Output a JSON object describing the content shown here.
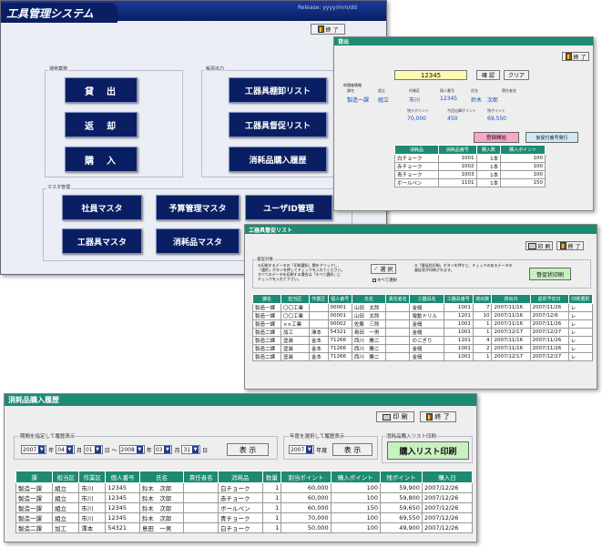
{
  "main": {
    "title": "工具管理システム",
    "release": "Release: yyyy/mm/dd",
    "exit": "終 了",
    "group_daily": "通常業務",
    "group_output": "帳票出力",
    "group_master": "マスタ管理",
    "btn_lend": "貸　出",
    "btn_return": "返　却",
    "btn_purchase": "購　入",
    "btn_inventory": "工器具棚卸リスト",
    "btn_reminder": "工器具督促リスト",
    "btn_history": "消耗品購入履歴",
    "btn_employee": "社員マスタ",
    "btn_budget": "予算管理マスタ",
    "btn_userid": "ユーザID管理",
    "btn_toolmaster": "工器具マスタ",
    "btn_consumable": "消耗品マスタ"
  },
  "lend": {
    "title": "貸出",
    "exit": "終 了",
    "id_value": "12345",
    "clear": "クリア",
    "confirm": "確 認",
    "employee_label": "申請者情報",
    "labels": [
      "課名",
      "組立",
      "作業区",
      "個人番号",
      "氏名",
      "責任者名"
    ],
    "values": [
      "製造一課",
      "組立",
      "市川",
      "12345",
      "鈴木　次郎"
    ],
    "label_row2": [
      "残りポイント",
      "今回出庫ポイント",
      "残ポイント"
    ],
    "values_row2": [
      "70,000",
      "450",
      "69,550"
    ],
    "btn_register": "登録開始",
    "btn_reissue": "仮受付番号発行",
    "headers": [
      "消耗品",
      "消耗品番号",
      "購入数",
      "購入ポイント"
    ],
    "rows": [
      [
        "白チョーク",
        "1001",
        "1本",
        "100"
      ],
      [
        "赤チョーク",
        "1002",
        "1本",
        "100"
      ],
      [
        "青チョーク",
        "1003",
        "1本",
        "100"
      ],
      [
        "ボールペン",
        "1101",
        "1本",
        "150"
      ]
    ]
  },
  "reminder": {
    "title": "工器具督促リスト",
    "print": "印 刷",
    "exit": "終 了",
    "group": "督促対象",
    "note1": "①印刷するデータの「印刷選択」欄をクリックし、",
    "note2": "「選択」ボタンを押してチェックを入れてください。",
    "note3": "すべてのデータを印刷する場合は「すべて選択」に",
    "note4": "チェックを入れて下さい。",
    "select": "選 択",
    "select_all": "すべて選択",
    "note5": "②「督促状印刷」ボタンを押すと、チェックのあるデータの",
    "note6": "督促状が印刷されます。",
    "btn_print": "督促状印刷",
    "headers": [
      "課名",
      "担当区",
      "作業区",
      "個人番号",
      "氏名",
      "責任者名",
      "工器具名",
      "工器具番号",
      "貸出数",
      "貸出日",
      "返却予定日",
      "印刷選択"
    ],
    "rows": [
      [
        "製造一課",
        "〇〇工業",
        "",
        "00001",
        "山田　太郎",
        "",
        "金槌",
        "1001",
        "7",
        "2007/11/16",
        "2007/11/26",
        "レ"
      ],
      [
        "製造一課",
        "〇〇工業",
        "",
        "00001",
        "山田　太郎",
        "",
        "電動ドリル",
        "1201",
        "10",
        "2007/11/16",
        "2007/12/6",
        "レ"
      ],
      [
        "製造一課",
        "××工業",
        "",
        "00002",
        "佐藤　三郎",
        "",
        "金槌",
        "1001",
        "1",
        "2007/11/16",
        "2007/11/26",
        "レ"
      ],
      [
        "製造二課",
        "加工",
        "澤本",
        "54321",
        "島田　一男",
        "",
        "金槌",
        "1001",
        "1",
        "2007/12/17",
        "2007/12/27",
        "レ"
      ],
      [
        "製造二課",
        "塗装",
        "金本",
        "71266",
        "西川　勝二",
        "",
        "のこぎり",
        "1101",
        "4",
        "2007/11/16",
        "2007/11/26",
        "レ"
      ],
      [
        "製造二課",
        "塗装",
        "金本",
        "71266",
        "西川　勝二",
        "",
        "金槌",
        "1001",
        "2",
        "2007/11/16",
        "2007/11/26",
        "レ"
      ],
      [
        "製造二課",
        "塗装",
        "金本",
        "71266",
        "西川　勝二",
        "",
        "金槌",
        "1001",
        "1",
        "2007/12/17",
        "2007/12/27",
        "レ"
      ]
    ]
  },
  "history": {
    "title": "消耗品購入履歴",
    "print": "印 刷",
    "exit": "終 了",
    "group1": "期間を指定して履歴表示",
    "group2": "年度を選択して履歴表示",
    "group3": "消耗品購入リスト印刷",
    "y1": "2007",
    "m1": "04",
    "d1": "01",
    "y2": "2008",
    "m2": "03",
    "d2": "31",
    "lbl_year": "年",
    "lbl_month": "月",
    "lbl_day": "日",
    "tilde": "日 ～",
    "fy": "2007",
    "lbl_fy": "年度",
    "show": "表 示",
    "btn_print_list": "購入リスト印刷",
    "headers": [
      "課",
      "担当区",
      "作業区",
      "個人番号",
      "氏名",
      "責任者名",
      "消耗品",
      "数量",
      "割当ポイント",
      "購入ポイント",
      "残ポイント",
      "購入日"
    ],
    "rows": [
      [
        "製造一課",
        "組立",
        "市川",
        "12345",
        "鈴木　次郎",
        "",
        "白チョーク",
        "1",
        "60,000",
        "100",
        "59,900",
        "2007/12/26"
      ],
      [
        "製造一課",
        "組立",
        "市川",
        "12345",
        "鈴木　次郎",
        "",
        "赤チョーク",
        "1",
        "60,000",
        "100",
        "59,800",
        "2007/12/26"
      ],
      [
        "製造一課",
        "組立",
        "市川",
        "12345",
        "鈴木　次郎",
        "",
        "ボールペン",
        "1",
        "60,000",
        "150",
        "59,650",
        "2007/12/26"
      ],
      [
        "製造一課",
        "組立",
        "市川",
        "12345",
        "鈴木　次郎",
        "",
        "青チョーク",
        "1",
        "70,000",
        "100",
        "69,550",
        "2007/12/26"
      ],
      [
        "製造二課",
        "加工",
        "澤本",
        "54321",
        "島田　一男",
        "",
        "白チョーク",
        "1",
        "50,000",
        "100",
        "49,900",
        "2007/12/26"
      ]
    ]
  },
  "colors": {
    "navy": "#0a1f63",
    "teal": "#1d8a72",
    "panel": "#eceef5"
  }
}
